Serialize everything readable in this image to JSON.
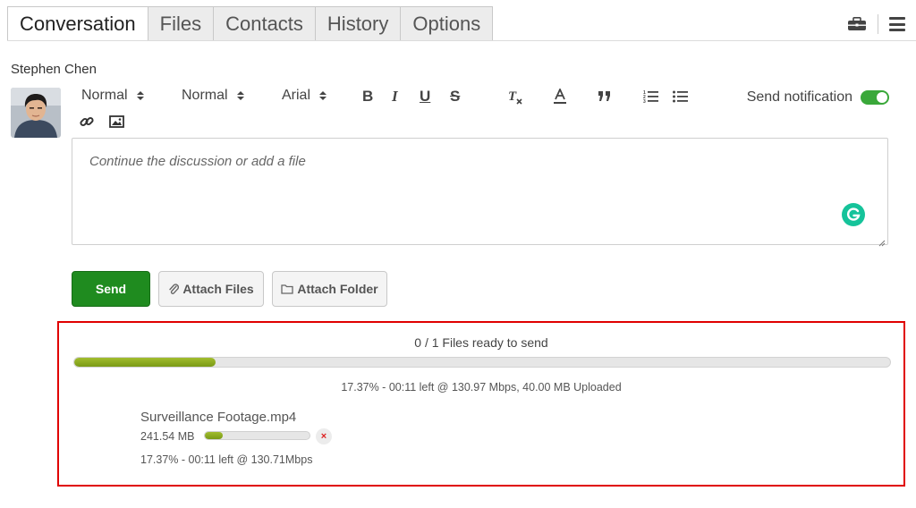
{
  "tabs": [
    {
      "label": "Conversation",
      "active": true
    },
    {
      "label": "Files",
      "active": false
    },
    {
      "label": "Contacts",
      "active": false
    },
    {
      "label": "History",
      "active": false
    },
    {
      "label": "Options",
      "active": false
    }
  ],
  "header_icons": [
    "briefcase-icon",
    "hamburger-menu-icon"
  ],
  "user": {
    "name": "Stephen Chen"
  },
  "toolbar": {
    "heading_select": "Normal",
    "size_select": "Normal",
    "font_select": "Arial",
    "buttons": [
      "bold",
      "italic",
      "underline",
      "strikethrough",
      "clear-format",
      "text-color",
      "blockquote",
      "ordered-list",
      "bullet-list",
      "link",
      "image"
    ],
    "bold_label": "B",
    "italic_label": "I",
    "underline_label": "U",
    "strike_label": "S"
  },
  "notification": {
    "label": "Send notification",
    "enabled": true,
    "color": "#3aa83a"
  },
  "editor": {
    "placeholder": "Continue the discussion or add a file"
  },
  "actions": {
    "send_label": "Send",
    "attach_files_label": "Attach Files",
    "attach_folder_label": "Attach Folder",
    "send_color": "#1f8b1f"
  },
  "upload": {
    "files_ready": "0 / 1 Files ready to send",
    "overall_progress_percent": 17.37,
    "overall_status": "17.37% - 00:11 left @ 130.97 Mbps, 40.00 MB Uploaded",
    "highlight_color": "#e00000",
    "files": [
      {
        "name": "Surveillance Footage.mp4",
        "size": "241.54 MB",
        "progress_percent": 17.37,
        "status": "17.37% - 00:11 left @ 130.71Mbps",
        "remove_label": "×"
      }
    ]
  }
}
